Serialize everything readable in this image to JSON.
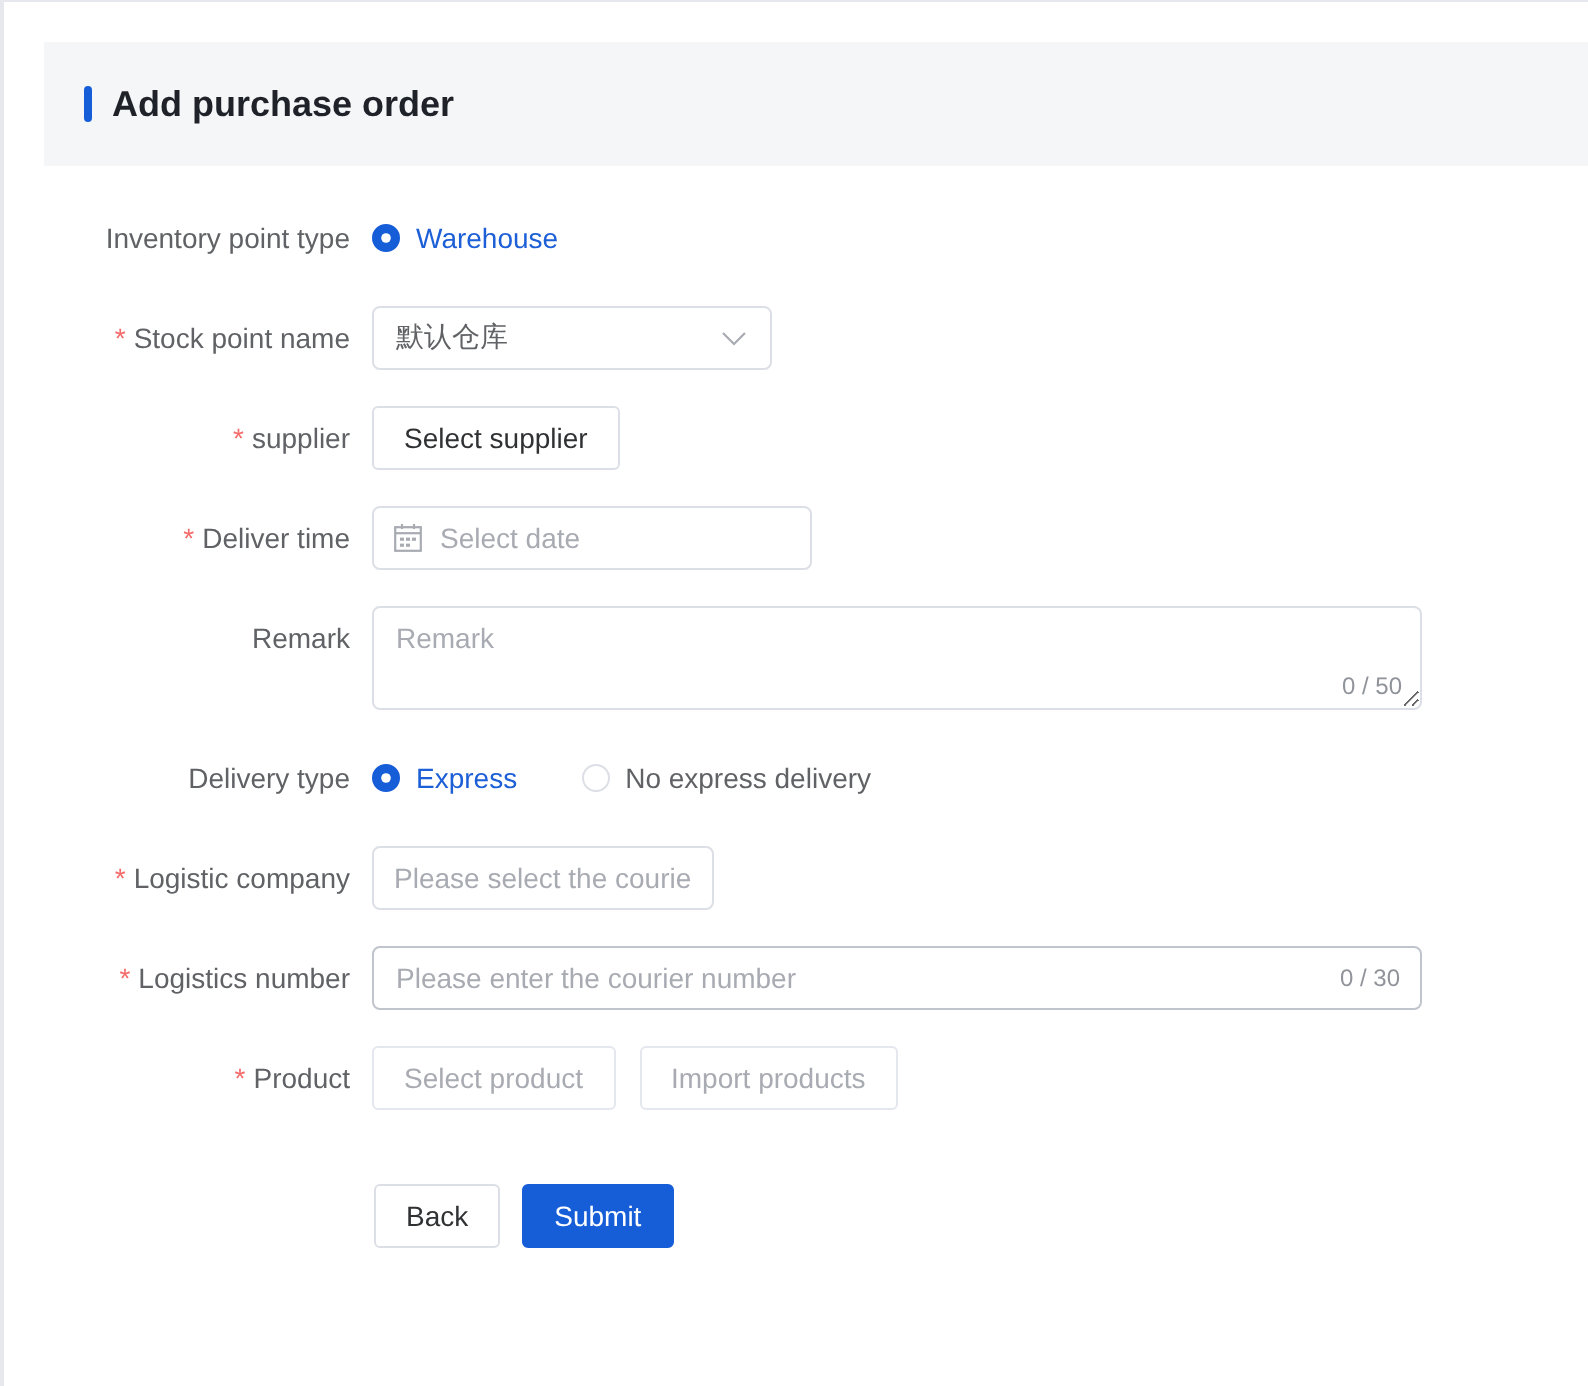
{
  "header": {
    "title": "Add purchase order"
  },
  "form": [
    {
      "kind": "radio",
      "label": "Inventory point type",
      "options": [
        {
          "label": "Warehouse",
          "selected": true
        }
      ]
    },
    {
      "kind": "select",
      "label": "Stock point name",
      "mark": "*",
      "value": "默认仓库"
    },
    {
      "kind": "buttons",
      "label": "supplier",
      "mark": "*",
      "buttons": [
        {
          "label": "Select supplier",
          "disabled": false
        }
      ]
    },
    {
      "kind": "date",
      "label": "Deliver time",
      "mark": "*",
      "placeholder": "Select date"
    },
    {
      "kind": "textarea",
      "label": "Remark",
      "placeholder": "Remark",
      "count": "0 / 50"
    },
    {
      "kind": "radio",
      "label": "Delivery type",
      "options": [
        {
          "label": "Express",
          "selected": true
        },
        {
          "label": "No express delivery",
          "selected": false
        }
      ]
    },
    {
      "kind": "picker",
      "label": "Logistic company",
      "mark": "*",
      "placeholder": "Please select the courie"
    },
    {
      "kind": "input",
      "label": "Logistics number",
      "mark": "*",
      "placeholder": "Please enter the courier number",
      "count": "0 / 30"
    },
    {
      "kind": "buttons",
      "label": "Product",
      "mark": "*",
      "buttons": [
        {
          "label": "Select product",
          "disabled": true
        },
        {
          "label": "Import products",
          "disabled": true
        }
      ]
    }
  ],
  "actions": [
    {
      "label": "Back",
      "kind": "default"
    },
    {
      "label": "Submit",
      "kind": "primary"
    }
  ]
}
